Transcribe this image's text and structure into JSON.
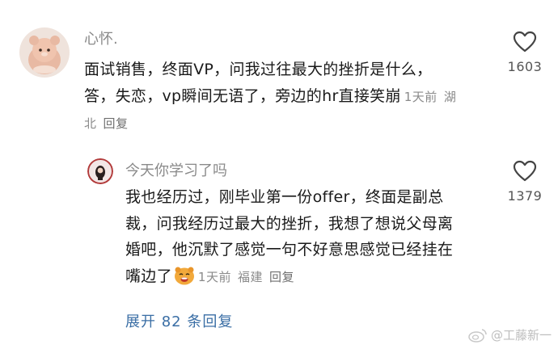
{
  "comment": {
    "username": "心怀.",
    "avatar": "plush-bear-avatar",
    "text": "面试销售，终面VP，问我过往最大的挫折是什么，答，失恋，vp瞬间无语了，旁边的hr直接笑崩",
    "time": "1天前",
    "location": "湖北",
    "reply_label": "回复",
    "likes": "1603"
  },
  "reply": {
    "username": "今天你学习了吗",
    "avatar": "girl-avatar",
    "text": "我也经历过，刚毕业第一份offer，终面是副总裁，问我经历过最大的挫折，我想了想说父母离婚吧，他沉默了感觉一句不好意思感觉已经挂在嘴边了",
    "emoji": "laughing-bear-emoji",
    "time": "1天前",
    "location": "福建",
    "reply_label": "回复",
    "likes": "1379"
  },
  "expand_label": "展开 82 条回复",
  "watermark": "@工藤新一",
  "icons": {
    "like": "heart-outline-icon",
    "watermark_logo": "weibo-logo-icon"
  },
  "colors": {
    "link": "#3a6ea5",
    "muted": "#8a8a8a"
  }
}
